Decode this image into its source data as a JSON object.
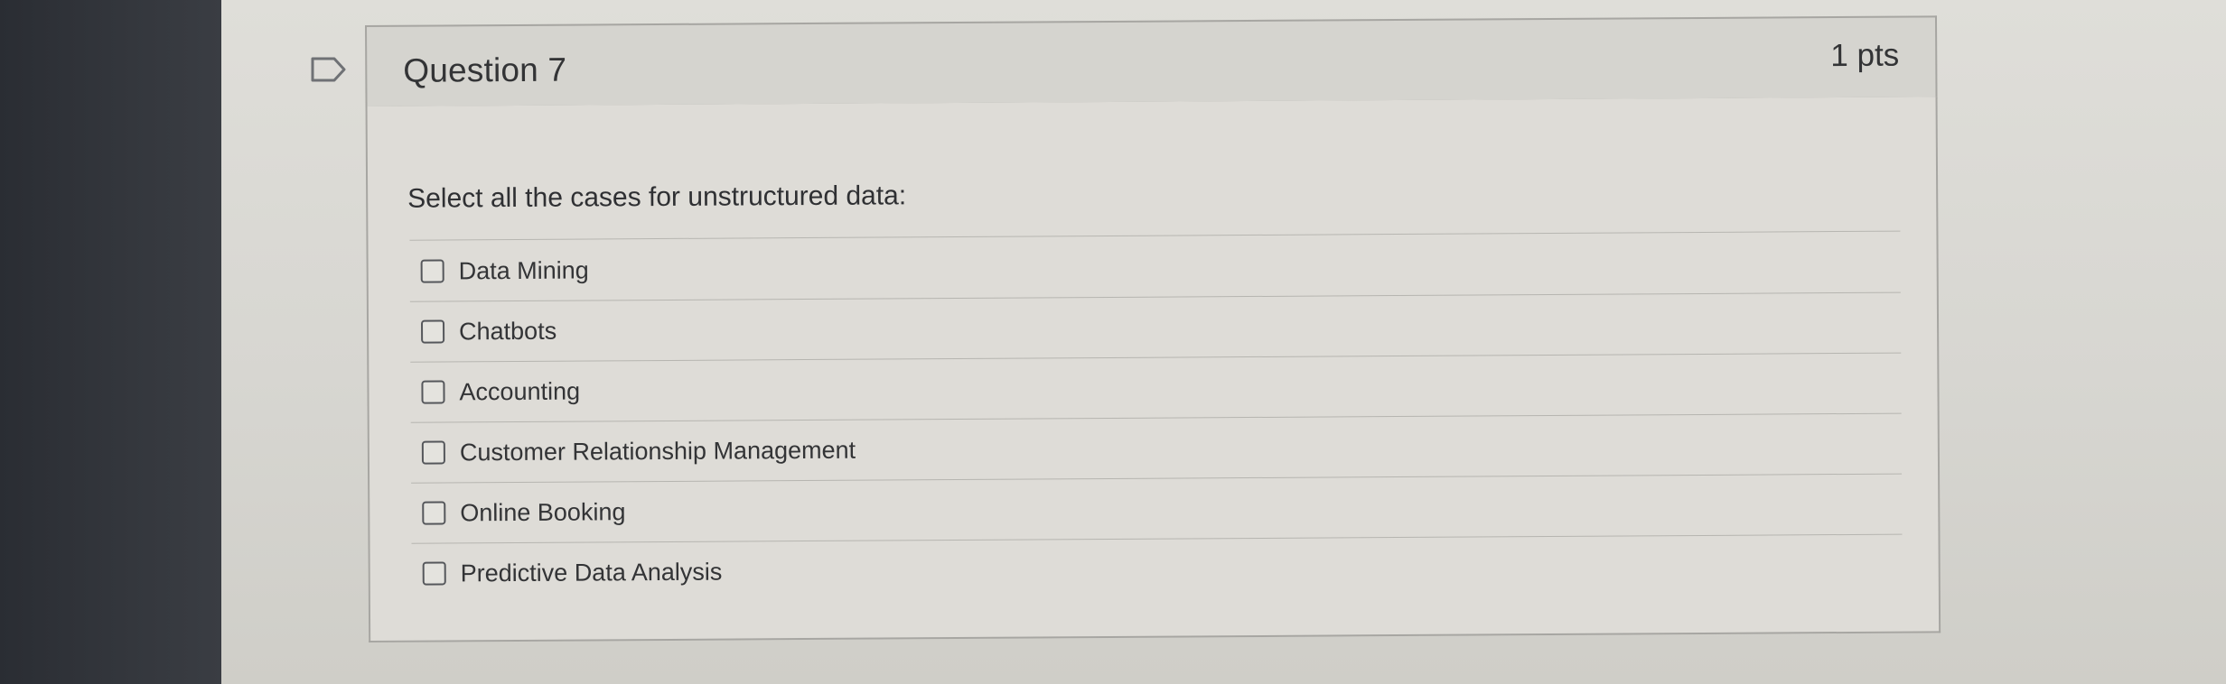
{
  "question": {
    "title": "Question 7",
    "points": "1 pts",
    "prompt": "Select all the cases for unstructured data:",
    "answers": [
      {
        "label": "Data Mining",
        "checked": false
      },
      {
        "label": "Chatbots",
        "checked": false
      },
      {
        "label": "Accounting",
        "checked": false
      },
      {
        "label": "Customer Relationship Management",
        "checked": false
      },
      {
        "label": "Online Booking",
        "checked": false
      },
      {
        "label": "Predictive Data Analysis",
        "checked": false
      }
    ]
  },
  "icons": {
    "flag": "flag-question-icon",
    "checkbox": "checkbox-icon"
  },
  "colors": {
    "text": "#333436",
    "border": "#a7a6a2",
    "header_bg": "#d5d4cf",
    "body_bg": "#dedcd7"
  }
}
